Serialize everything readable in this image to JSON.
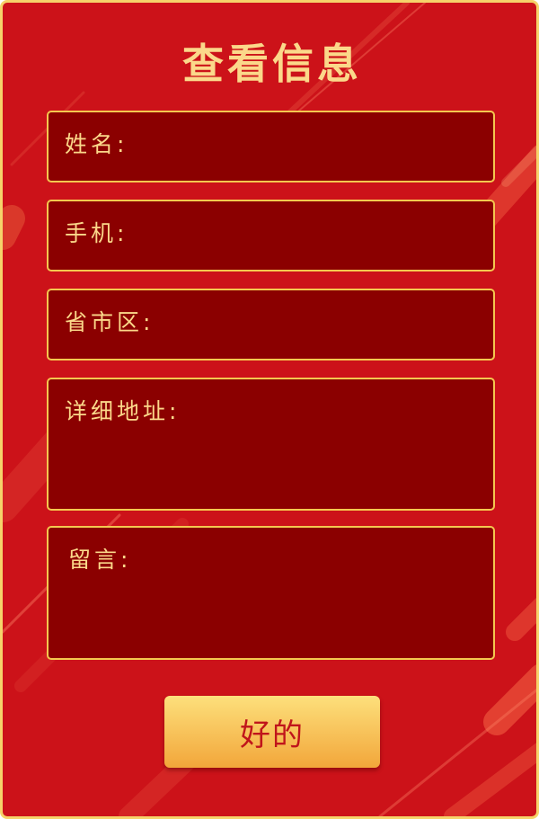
{
  "dialog": {
    "title": "查看信息",
    "fields": [
      {
        "label": "姓名:",
        "value": ""
      },
      {
        "label": "手机:",
        "value": ""
      },
      {
        "label": "省市区:",
        "value": ""
      },
      {
        "label": "详细地址:",
        "value": ""
      },
      {
        "label": "留言:",
        "value": ""
      }
    ],
    "confirm_label": "好的"
  },
  "colors": {
    "background": "#cc1219",
    "field_background": "#8b0000",
    "border_gold": "#f4c84f",
    "text_gold": "#fbd88a",
    "button_top": "#fde07c",
    "button_bottom": "#f2a63a",
    "button_text": "#c0151b"
  }
}
